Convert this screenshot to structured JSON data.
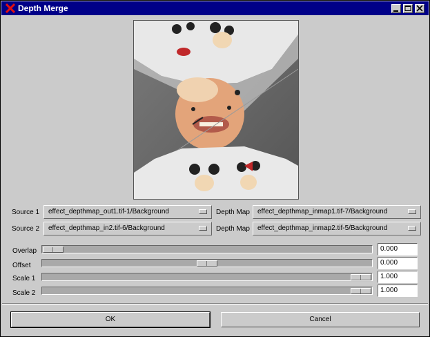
{
  "window": {
    "title": "Depth Merge"
  },
  "sources": [
    {
      "label": "Source 1",
      "value": "effect_depthmap_out1.tif-1/Background",
      "depth_label": "Depth Map",
      "depth_value": "effect_depthmap_inmap1.tif-7/Background"
    },
    {
      "label": "Source 2",
      "value": "effect_depthmap_in2.tif-6/Background",
      "depth_label": "Depth Map",
      "depth_value": "effect_depthmap_inmap2.tif-5/Background"
    }
  ],
  "sliders": [
    {
      "label": "Overlap",
      "value": "0.000",
      "position": 0.0
    },
    {
      "label": "Offset",
      "value": "0.000",
      "position": 0.5
    },
    {
      "label": "Scale 1",
      "value": "1.000",
      "position": 1.0
    },
    {
      "label": "Scale 2",
      "value": "1.000",
      "position": 1.0
    }
  ],
  "buttons": {
    "ok": "OK",
    "cancel": "Cancel"
  },
  "colors": {
    "titlebar": "#000088",
    "background": "#cbcbcb"
  }
}
